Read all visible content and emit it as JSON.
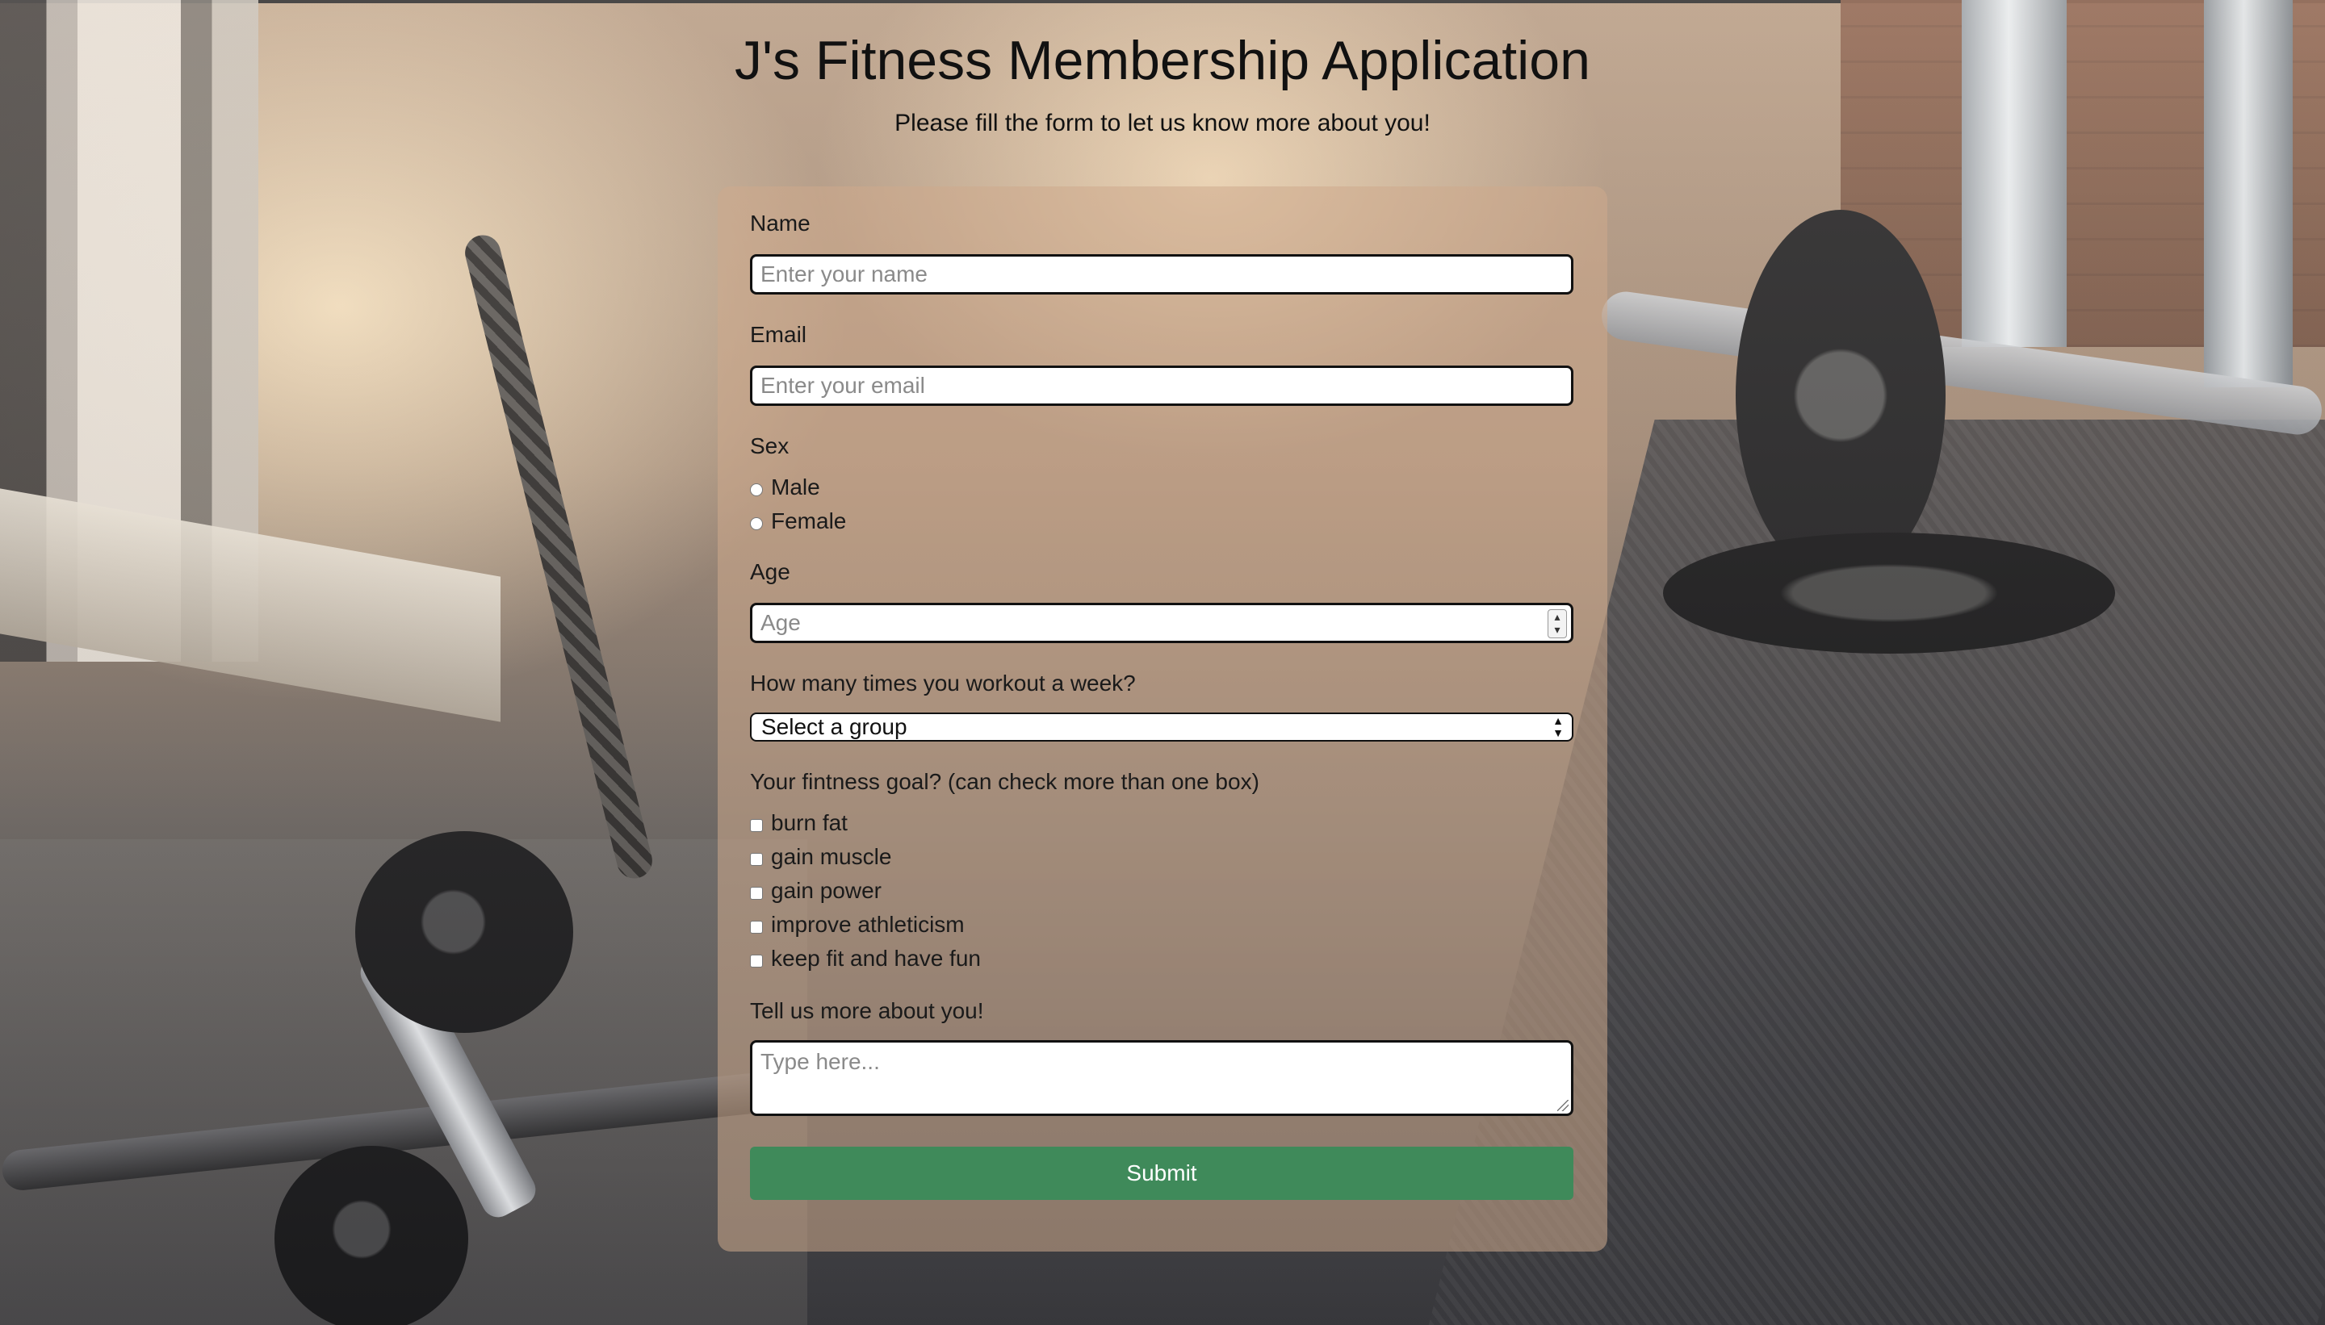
{
  "header": {
    "title": "J's Fitness Membership Application",
    "subtitle": "Please fill the form to let us know more about you!"
  },
  "form": {
    "name": {
      "label": "Name",
      "placeholder": "Enter your name",
      "value": ""
    },
    "email": {
      "label": "Email",
      "placeholder": "Enter your email",
      "value": ""
    },
    "sex": {
      "label": "Sex",
      "options": [
        "Male",
        "Female"
      ],
      "selected": null
    },
    "age": {
      "label": "Age",
      "placeholder": "Age",
      "value": ""
    },
    "workouts": {
      "label": "How many times you workout a week?",
      "selected": "Select a group"
    },
    "goals": {
      "label": "Your fintness goal? (can check more than one box)",
      "options": [
        "burn fat",
        "gain muscle",
        "gain power",
        "improve athleticism",
        "keep fit and have fun"
      ],
      "checked": []
    },
    "about": {
      "label": "Tell us more about you!",
      "placeholder": "Type here...",
      "value": ""
    },
    "submit_label": "Submit"
  },
  "colors": {
    "submit_button": "#3f8a5a",
    "card_tint": "#cdaa8c"
  },
  "background": {
    "image": "gym-floor-with-dumbbells"
  }
}
